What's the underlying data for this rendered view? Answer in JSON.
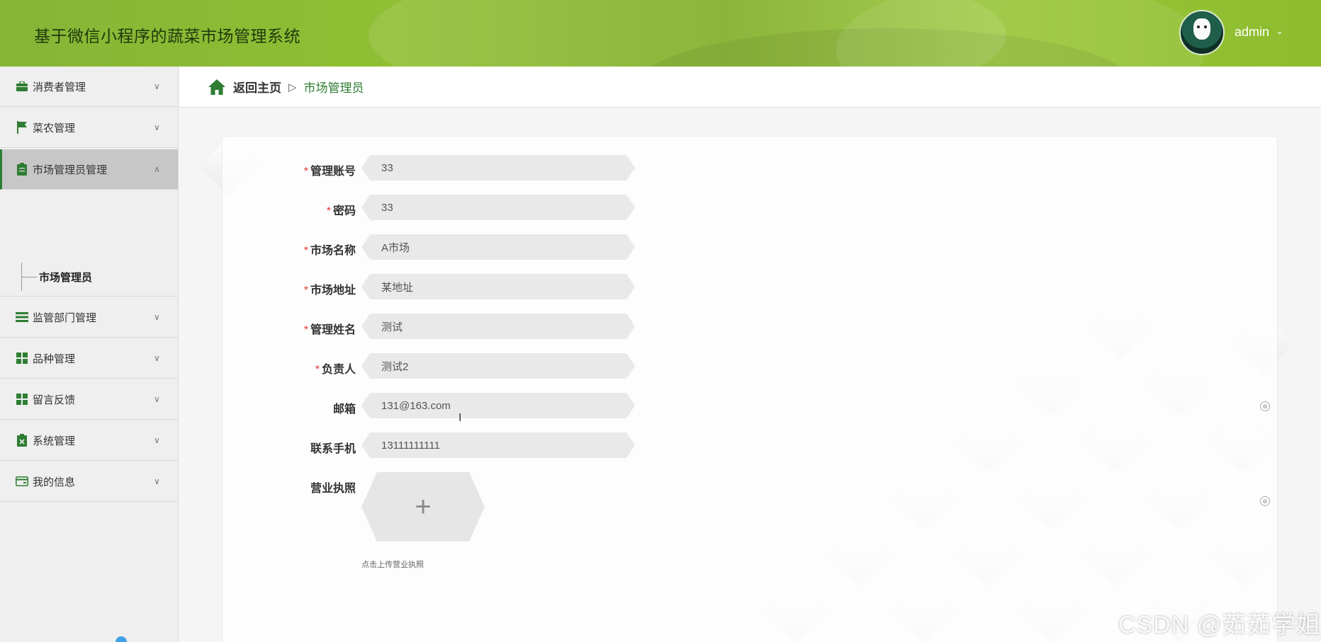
{
  "header": {
    "title": "基于微信小程序的蔬菜市场管理系统",
    "user": "admin",
    "caret": "⌄"
  },
  "sidebar": {
    "items": [
      {
        "label": "消费者管理",
        "icon": "briefcase-icon",
        "arrow": "∨"
      },
      {
        "label": "菜农管理",
        "icon": "flag-icon",
        "arrow": "∨"
      },
      {
        "label": "市场管理员管理",
        "icon": "clipboard-icon",
        "arrow": "∧"
      },
      {
        "label": "监管部门管理",
        "icon": "list-icon",
        "arrow": "∨"
      },
      {
        "label": "品种管理",
        "icon": "grid-icon",
        "arrow": "∨"
      },
      {
        "label": "留言反馈",
        "icon": "grid-icon",
        "arrow": "∨"
      },
      {
        "label": "系统管理",
        "icon": "clipboard-x-icon",
        "arrow": "∨"
      },
      {
        "label": "我的信息",
        "icon": "card-icon",
        "arrow": "∨"
      }
    ],
    "submenu": {
      "label": "市场管理员"
    }
  },
  "breadcrumb": {
    "home": "返回主页",
    "separator": "▷",
    "current": "市场管理员"
  },
  "form": {
    "required_mark": "*",
    "fields": [
      {
        "label": "管理账号",
        "value": "33",
        "required": true
      },
      {
        "label": "密码",
        "value": "33",
        "required": true
      },
      {
        "label": "市场名称",
        "value": "A市场",
        "required": true
      },
      {
        "label": "市场地址",
        "value": "某地址",
        "required": true
      },
      {
        "label": "管理姓名",
        "value": "测试",
        "required": true
      },
      {
        "label": "负责人",
        "value": "测试2",
        "required": true
      },
      {
        "label": "邮箱",
        "value": "131@163.com",
        "required": false
      },
      {
        "label": "联系手机",
        "value": "13111111111",
        "required": false
      }
    ],
    "upload": {
      "label": "营业执照",
      "plus": "+",
      "hint": "点击上传营业执照"
    },
    "clear_symbol": "⊗"
  },
  "cursor": "I",
  "watermark": "CSDN @茹茹学姐",
  "colors": {
    "accent": "#2e7d32",
    "header": "#8cbc2e",
    "required": "#e53935"
  }
}
